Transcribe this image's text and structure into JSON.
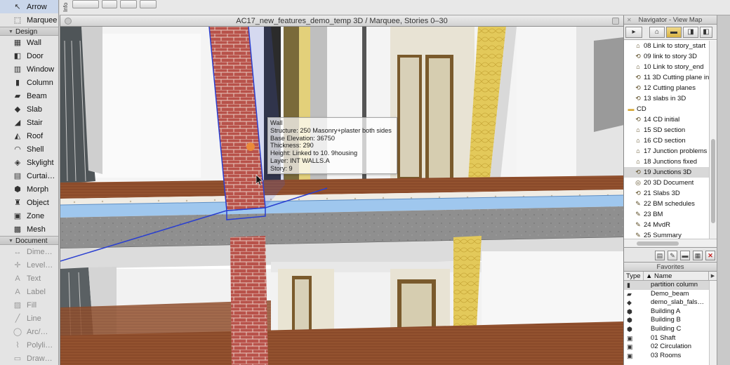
{
  "toolbox": {
    "top_tools": [
      {
        "label": "Arrow",
        "icon": "arrow-icon",
        "glyph": "↖",
        "selected": true
      },
      {
        "label": "Marquee",
        "icon": "marquee-icon",
        "glyph": "⬚",
        "selected": false
      }
    ],
    "design_section": "Design",
    "design_tools": [
      {
        "label": "Wall",
        "icon": "wall-icon",
        "glyph": "▦"
      },
      {
        "label": "Door",
        "icon": "door-icon",
        "glyph": "◧"
      },
      {
        "label": "Window",
        "icon": "window-icon",
        "glyph": "▥"
      },
      {
        "label": "Column",
        "icon": "column-icon",
        "glyph": "▮"
      },
      {
        "label": "Beam",
        "icon": "beam-icon",
        "glyph": "▰"
      },
      {
        "label": "Slab",
        "icon": "slab-icon",
        "glyph": "◆"
      },
      {
        "label": "Stair",
        "icon": "stair-icon",
        "glyph": "◢"
      },
      {
        "label": "Roof",
        "icon": "roof-icon",
        "glyph": "◭"
      },
      {
        "label": "Shell",
        "icon": "shell-icon",
        "glyph": "◠"
      },
      {
        "label": "Skylight",
        "icon": "skylight-icon",
        "glyph": "◈"
      },
      {
        "label": "Curtai…",
        "icon": "curtain-wall-icon",
        "glyph": "▤"
      },
      {
        "label": "Morph",
        "icon": "morph-icon",
        "glyph": "⬢"
      },
      {
        "label": "Object",
        "icon": "object-icon",
        "glyph": "♜"
      },
      {
        "label": "Zone",
        "icon": "zone-icon",
        "glyph": "▣"
      },
      {
        "label": "Mesh",
        "icon": "mesh-icon",
        "glyph": "▩"
      }
    ],
    "document_section": "Document",
    "document_tools": [
      {
        "label": "Dime…",
        "icon": "dimension-icon",
        "glyph": "↔"
      },
      {
        "label": "Level…",
        "icon": "level-dimension-icon",
        "glyph": "✛"
      },
      {
        "label": "Text",
        "icon": "text-icon",
        "glyph": "A"
      },
      {
        "label": "Label",
        "icon": "label-icon",
        "glyph": "A"
      },
      {
        "label": "Fill",
        "icon": "fill-icon",
        "glyph": "▨"
      },
      {
        "label": "Line",
        "icon": "line-icon",
        "glyph": "╱"
      },
      {
        "label": "Arc/…",
        "icon": "arc-icon",
        "glyph": "◯"
      },
      {
        "label": "Polyli…",
        "icon": "polyline-icon",
        "glyph": "⌇"
      },
      {
        "label": "Draw…",
        "icon": "drawing-icon",
        "glyph": "▭"
      }
    ]
  },
  "infobar": {
    "tab_label": "Info"
  },
  "window3d": {
    "title": "AC17_new_features_demo_temp 3D / Marquee, Stories 0–30"
  },
  "tooltip": {
    "lines": [
      "Wall",
      "Structure: 250 Masonry+plaster both sides",
      "Base Elevation: 36750",
      "Thickness: 290",
      "Height: Linked to 10. 9housing",
      "Layer: INT WALLS.A",
      "Story: 9"
    ]
  },
  "navigator": {
    "title": "Navigator - View Map",
    "items": [
      {
        "label": "08 Link to story_start",
        "icon": "view-icon",
        "glyph": "⌂",
        "folder": false,
        "selected": false
      },
      {
        "label": "09 link to story 3D",
        "icon": "view-3d-icon",
        "glyph": "⟲",
        "folder": false,
        "selected": false
      },
      {
        "label": "10 Link to story_end",
        "icon": "view-icon",
        "glyph": "⌂",
        "folder": false,
        "selected": false
      },
      {
        "label": "11 3D Cutting plane in",
        "icon": "view-3d-icon",
        "glyph": "⟲",
        "folder": false,
        "selected": false
      },
      {
        "label": "12 Cutting planes",
        "icon": "view-3d-icon",
        "glyph": "⟲",
        "folder": false,
        "selected": false
      },
      {
        "label": "13 slabs in 3D",
        "icon": "view-3d-icon",
        "glyph": "⟲",
        "folder": false,
        "selected": false
      },
      {
        "label": "CD",
        "icon": "folder-icon",
        "glyph": "▬",
        "folder": true,
        "selected": false
      },
      {
        "label": "14 CD initial",
        "icon": "view-3d-icon",
        "glyph": "⟲",
        "folder": false,
        "selected": false
      },
      {
        "label": "15 SD section",
        "icon": "view-icon",
        "glyph": "⌂",
        "folder": false,
        "selected": false
      },
      {
        "label": "16 CD section",
        "icon": "view-icon",
        "glyph": "⌂",
        "folder": false,
        "selected": false
      },
      {
        "label": "17 Junction problems",
        "icon": "view-icon",
        "glyph": "⌂",
        "folder": false,
        "selected": false
      },
      {
        "label": "18 Junctions fixed",
        "icon": "view-icon",
        "glyph": "⌂",
        "folder": false,
        "selected": false
      },
      {
        "label": "19 Junctions 3D",
        "icon": "view-3d-icon",
        "glyph": "⟲",
        "folder": false,
        "selected": true
      },
      {
        "label": "20 3D Document",
        "icon": "3d-document-icon",
        "glyph": "◎",
        "folder": false,
        "selected": false
      },
      {
        "label": "21 Slabs 3D",
        "icon": "view-3d-icon",
        "glyph": "⟲",
        "folder": false,
        "selected": false
      },
      {
        "label": "22 BM schedules",
        "icon": "schedule-icon",
        "glyph": "✎",
        "folder": false,
        "selected": false
      },
      {
        "label": "23 BM",
        "icon": "schedule-icon",
        "glyph": "✎",
        "folder": false,
        "selected": false
      },
      {
        "label": "24 MvdR",
        "icon": "schedule-icon",
        "glyph": "✎",
        "folder": false,
        "selected": false
      },
      {
        "label": "25 Summary",
        "icon": "schedule-icon",
        "glyph": "✎",
        "folder": false,
        "selected": false
      }
    ]
  },
  "favorites": {
    "title": "Favorites",
    "col_type": "Type",
    "col_name": "Name",
    "items": [
      {
        "name": "partition column",
        "icon": "column-icon",
        "glyph": "▮",
        "selected": true
      },
      {
        "name": "Demo_beam",
        "icon": "beam-icon",
        "glyph": "▰",
        "selected": false
      },
      {
        "name": "demo_slab_fals…",
        "icon": "slab-icon",
        "glyph": "◆",
        "selected": false
      },
      {
        "name": "Building A",
        "icon": "morph-icon",
        "glyph": "⬢",
        "selected": false
      },
      {
        "name": "Building B",
        "icon": "morph-icon",
        "glyph": "⬢",
        "selected": false
      },
      {
        "name": "Building C",
        "icon": "morph-icon",
        "glyph": "⬢",
        "selected": false
      },
      {
        "name": "01 Shaft",
        "icon": "zone-icon",
        "glyph": "▣",
        "selected": false
      },
      {
        "name": "02 Circulation",
        "icon": "zone-icon",
        "glyph": "▣",
        "selected": false
      },
      {
        "name": "03 Rooms",
        "icon": "zone-icon",
        "glyph": "▣",
        "selected": false
      }
    ]
  },
  "colors": {
    "brick": "#b8524a",
    "selection_blue": "#2a3fd0",
    "slab_blue": "#9fc7ee",
    "floor_wood": "#8a4a2a",
    "insulation_yellow": "#e3c95a"
  }
}
